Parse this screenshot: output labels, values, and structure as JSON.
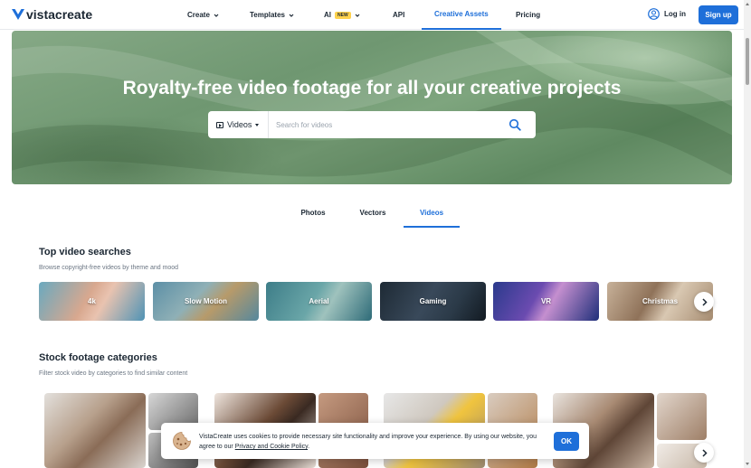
{
  "brand": {
    "name": "vistacreate",
    "accent": "#1e6fd9",
    "badge_color": "#ffd24d"
  },
  "nav": {
    "items": [
      {
        "label": "Create",
        "has_chevron": true
      },
      {
        "label": "Templates",
        "has_chevron": true
      },
      {
        "label": "AI",
        "badge": "NEW",
        "has_chevron": true
      },
      {
        "label": "API"
      },
      {
        "label": "Creative Assets",
        "active": true
      },
      {
        "label": "Pricing"
      }
    ],
    "login_label": "Log in",
    "signup_label": "Sign up"
  },
  "hero": {
    "title": "Royalty-free video footage for all your creative projects",
    "search_type": "Videos",
    "search_placeholder": "Search for videos"
  },
  "tabs": [
    {
      "label": "Photos"
    },
    {
      "label": "Vectors"
    },
    {
      "label": "Videos",
      "active": true
    }
  ],
  "top_searches": {
    "title": "Top video searches",
    "subtitle": "Browse copyright-free videos by theme and mood",
    "items": [
      {
        "label": "4k"
      },
      {
        "label": "Slow Motion"
      },
      {
        "label": "Aerial"
      },
      {
        "label": "Gaming"
      },
      {
        "label": "VR"
      },
      {
        "label": "Christmas"
      }
    ]
  },
  "categories": {
    "title": "Stock footage categories",
    "subtitle": "Filter stock video by categories to find similar content"
  },
  "cookie": {
    "text": "VistaCreate uses cookies to provide necessary site functionality and improve your experience. By using our website, you agree to our ",
    "link": "Privacy and Cookie Policy",
    "end": ".",
    "ok_label": "OK"
  }
}
